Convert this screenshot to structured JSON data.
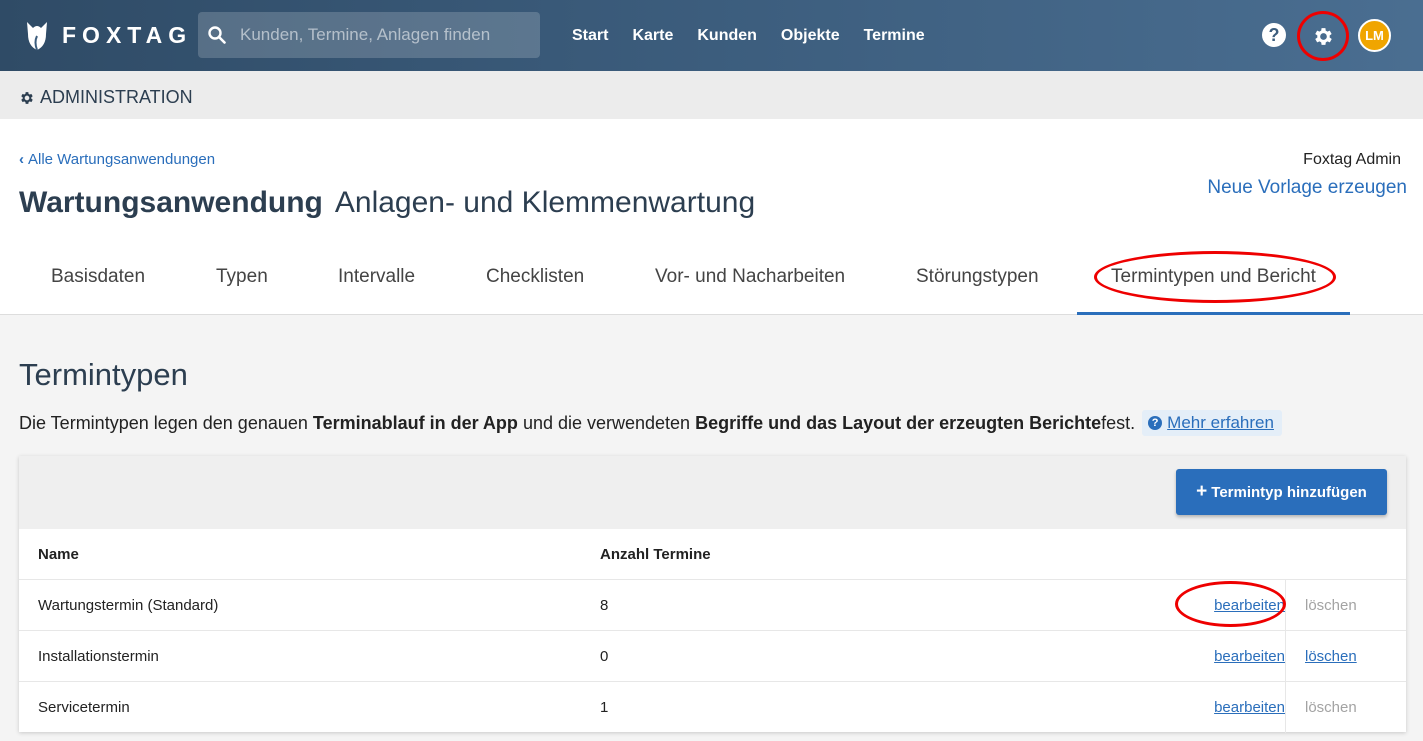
{
  "header": {
    "logo_text": "FOXTAG",
    "search_placeholder": "Kunden, Termine, Anlagen finden",
    "nav": [
      "Start",
      "Karte",
      "Kunden",
      "Objekte",
      "Termine"
    ],
    "help_label": "?",
    "avatar_initials": "LM"
  },
  "admin": {
    "title": "ADMINISTRATION"
  },
  "page": {
    "back_link": "Alle Wartungsanwendungen",
    "title_main": "Wartungsanwendung",
    "title_sub": "Anlagen- und Klemmenwartung",
    "owner": "Foxtag Admin",
    "new_template": "Neue Vorlage erzeugen",
    "tabs": [
      "Basisdaten",
      "Typen",
      "Intervalle",
      "Checklisten",
      "Vor- und Nacharbeiten",
      "Störungstypen",
      "Termintypen und Bericht"
    ],
    "active_tab": "Termintypen und Bericht"
  },
  "section": {
    "title": "Termintypen",
    "desc_1": "Die Termintypen legen den genauen ",
    "desc_bold_1": "Terminablauf in der App",
    "desc_2": " und die verwendeten ",
    "desc_bold_2": "Begriffe und das Layout der erzeugten Berichte",
    "desc_3": " fest.",
    "more_link": "Mehr erfahren"
  },
  "table": {
    "add_button": "Termintyp hinzufügen",
    "columns": [
      "Name",
      "Anzahl Termine"
    ],
    "rows": [
      {
        "name": "Wartungstermin (Standard)",
        "count": "8",
        "edit": "bearbeiten",
        "delete": "löschen",
        "delete_enabled": false
      },
      {
        "name": "Installationstermin",
        "count": "0",
        "edit": "bearbeiten",
        "delete": "löschen",
        "delete_enabled": true
      },
      {
        "name": "Servicetermin",
        "count": "1",
        "edit": "bearbeiten",
        "delete": "löschen",
        "delete_enabled": false
      }
    ]
  },
  "colors": {
    "nav_bg": "#3c5d7d",
    "link": "#2a6ebb",
    "annotation": "#ee0000",
    "avatar": "#f0a500"
  }
}
